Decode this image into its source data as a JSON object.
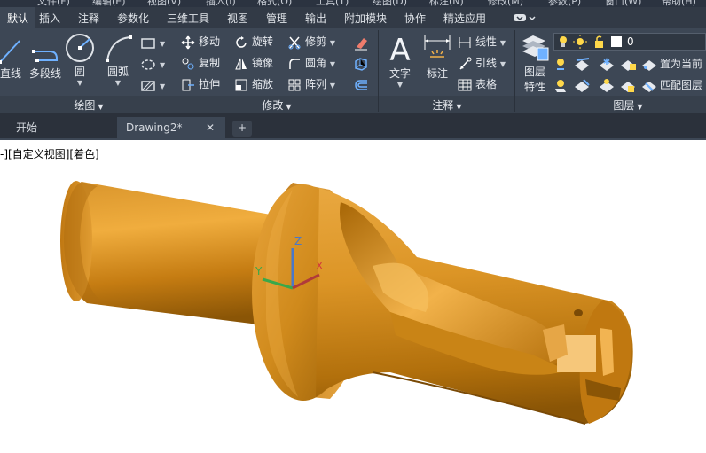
{
  "menu_bar": {
    "items": [
      "文件(F)",
      "编辑(E)",
      "视图(V)",
      "插入(I)",
      "格式(O)",
      "工具(T)",
      "绘图(D)",
      "标注(N)",
      "修改(M)",
      "参数(P)",
      "窗口(W)",
      "帮助(H)"
    ]
  },
  "ribbon_tabs": {
    "items": [
      "默认",
      "插入",
      "注释",
      "参数化",
      "三维工具",
      "视图",
      "管理",
      "输出",
      "附加模块",
      "协作",
      "精选应用"
    ],
    "active": "默认"
  },
  "draw_panel": {
    "title": "绘图",
    "line": "直线",
    "polyline": "多段线",
    "circle": "圆",
    "arc": "圆弧"
  },
  "modify_panel": {
    "title": "修改",
    "move": "移动",
    "rotate": "旋转",
    "trim": "修剪",
    "copy": "复制",
    "mirror": "镜像",
    "fillet": "圆角",
    "stretch": "拉伸",
    "scale": "缩放",
    "array": "阵列"
  },
  "annotation_panel": {
    "title": "注释",
    "text": "文字",
    "dimension": "标注",
    "linear": "线性",
    "leader": "引线",
    "table": "表格"
  },
  "layers_panel": {
    "title": "图层",
    "properties_line1": "图层",
    "properties_line2": "特性",
    "layer_name": "0",
    "set_current": "置为当前",
    "match_layer": "匹配图层"
  },
  "doc_tabs": {
    "start": "开始",
    "drawing": "Drawing2*",
    "close": "✕",
    "new": "+"
  },
  "viewport": {
    "label": "-][自定义视图][着色]"
  },
  "ucs": {
    "x": "X",
    "y": "Y",
    "z": "Z"
  },
  "colors": {
    "ribbon_bg": "#3d4755",
    "tabs_bg": "#323a46",
    "model_gold": "#d18a18",
    "model_shadow": "#8a5506",
    "model_highlight": "#f2b24a"
  }
}
